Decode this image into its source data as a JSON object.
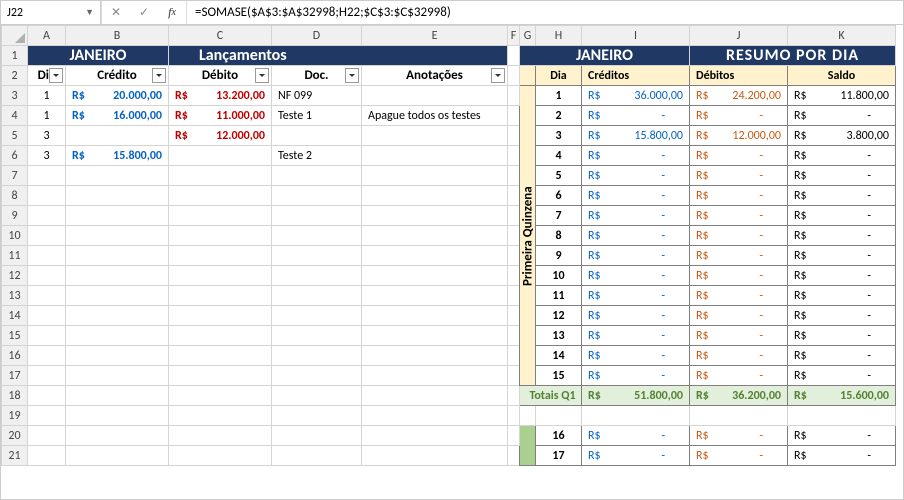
{
  "namebox": "J22",
  "formula": "=SOMASE($A$3:$A$32998;H22;$C$3:$C$32998)",
  "columns": [
    "A",
    "B",
    "C",
    "D",
    "E",
    "F",
    "G",
    "H",
    "I",
    "J",
    "K"
  ],
  "title": {
    "left_month": "JANEIRO",
    "left_main": "Lançamentos",
    "right_month": "JANEIRO",
    "right_main": "RESUMO POR DIA"
  },
  "left_headers": {
    "dia": "Dia",
    "credito": "Crédito",
    "debito": "Débito",
    "doc": "Doc.",
    "anot": "Anotações"
  },
  "right_headers": {
    "dia": "Dia",
    "creditos": "Créditos",
    "debitos": "Débitos",
    "saldo": "Saldo"
  },
  "currency": "R$",
  "quinzena_label": "Primeira Quinzena",
  "totals_q1_label": "Totais Q1",
  "left_rows": [
    {
      "dia": "1",
      "credito": "20.000,00",
      "debito": "13.200,00",
      "doc": "NF 099",
      "anot": ""
    },
    {
      "dia": "1",
      "credito": "16.000,00",
      "debito": "11.000,00",
      "doc": "Teste 1",
      "anot": "Apague todos os testes"
    },
    {
      "dia": "3",
      "credito": "",
      "debito": "12.000,00",
      "doc": "",
      "anot": ""
    },
    {
      "dia": "3",
      "credito": "15.800,00",
      "debito": "",
      "doc": "Teste 2",
      "anot": ""
    }
  ],
  "summary": [
    {
      "dia": "1",
      "cred": "36.000,00",
      "deb": "24.200,00",
      "saldo": "11.800,00"
    },
    {
      "dia": "2",
      "cred": "-",
      "deb": "-",
      "saldo": "-"
    },
    {
      "dia": "3",
      "cred": "15.800,00",
      "deb": "12.000,00",
      "saldo": "3.800,00"
    },
    {
      "dia": "4",
      "cred": "-",
      "deb": "-",
      "saldo": "-"
    },
    {
      "dia": "5",
      "cred": "-",
      "deb": "-",
      "saldo": "-"
    },
    {
      "dia": "6",
      "cred": "-",
      "deb": "-",
      "saldo": "-"
    },
    {
      "dia": "7",
      "cred": "-",
      "deb": "-",
      "saldo": "-"
    },
    {
      "dia": "8",
      "cred": "-",
      "deb": "-",
      "saldo": "-"
    },
    {
      "dia": "9",
      "cred": "-",
      "deb": "-",
      "saldo": "-"
    },
    {
      "dia": "10",
      "cred": "-",
      "deb": "-",
      "saldo": "-"
    },
    {
      "dia": "11",
      "cred": "-",
      "deb": "-",
      "saldo": "-"
    },
    {
      "dia": "12",
      "cred": "-",
      "deb": "-",
      "saldo": "-"
    },
    {
      "dia": "13",
      "cred": "-",
      "deb": "-",
      "saldo": "-"
    },
    {
      "dia": "14",
      "cred": "-",
      "deb": "-",
      "saldo": "-"
    },
    {
      "dia": "15",
      "cred": "-",
      "deb": "-",
      "saldo": "-"
    }
  ],
  "totals_q1": {
    "cred": "51.800,00",
    "deb": "36.200,00",
    "saldo": "15.600,00"
  },
  "summary2": [
    {
      "dia": "16",
      "cred": "-",
      "deb": "-",
      "saldo": "-"
    },
    {
      "dia": "17",
      "cred": "-",
      "deb": "-",
      "saldo": "-"
    }
  ]
}
